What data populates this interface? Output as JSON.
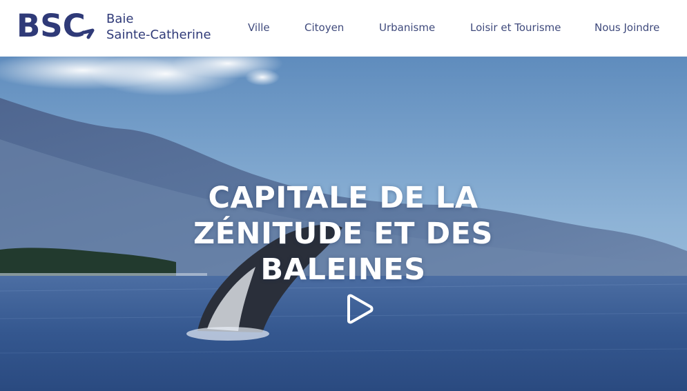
{
  "header": {
    "logo": {
      "letters": "BSC",
      "line1": "Baie",
      "line2": "Sainte-Catherine"
    },
    "nav": [
      {
        "label": "Ville"
      },
      {
        "label": "Citoyen"
      },
      {
        "label": "Urbanisme"
      },
      {
        "label": "Loisir et Tourisme"
      },
      {
        "label": "Nous Joindre"
      }
    ]
  },
  "hero": {
    "title_line1": "CAPITALE DE LA",
    "title_line2": "ZÉNITUDE ET DES",
    "title_line3": "BALEINES",
    "play_icon": "play-icon"
  },
  "colors": {
    "brand": "#2f3a78",
    "nav_text": "#3f4a7c",
    "hero_text": "#ffffff"
  }
}
